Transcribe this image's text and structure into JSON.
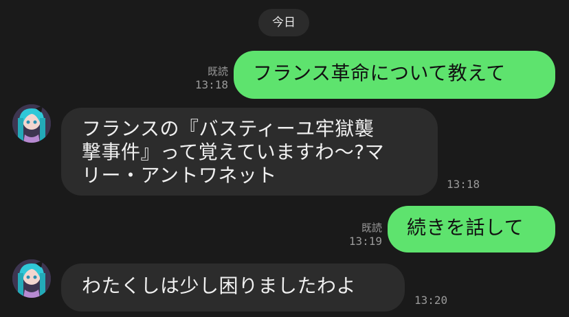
{
  "date_separator": "今日",
  "messages": [
    {
      "direction": "out",
      "text": "フランス革命について教えて",
      "read_label": "既読",
      "time": "13:18"
    },
    {
      "direction": "in",
      "lines": [
        "フランスの『バスティーユ牢獄襲",
        "撃事件』って覚えていますわ〜?マ",
        "リー・アントワネット"
      ],
      "time": "13:18"
    },
    {
      "direction": "out",
      "text": "続きを話して",
      "read_label": "既読",
      "time": "13:19"
    },
    {
      "direction": "in",
      "text": "わたくしは少し困りましたわよ",
      "time": "13:20"
    }
  ],
  "colors": {
    "background": "#1a1a1a",
    "outgoing_bubble": "#5ee36e",
    "incoming_bubble": "#2c2c2c",
    "meta_text": "#9a9a9a"
  }
}
